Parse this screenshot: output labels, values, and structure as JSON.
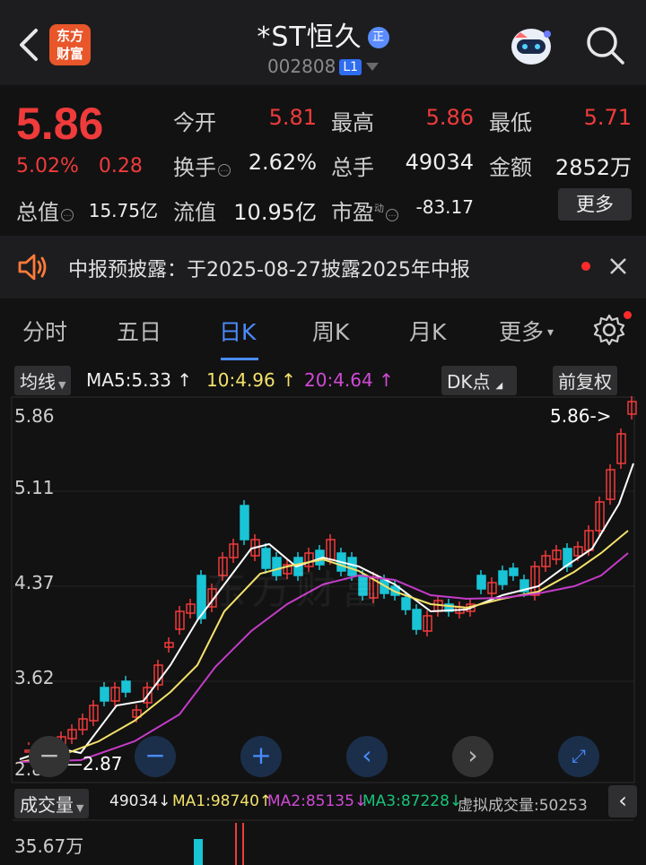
{
  "header": {
    "logo_line1": "东方",
    "logo_line2": "财富",
    "stock_name": "*ST恒久",
    "badge": "正",
    "stock_code": "002808",
    "level": "L1"
  },
  "quote": {
    "price": "5.86",
    "change_pct": "5.02%",
    "change_abs": "0.28",
    "open_label": "今开",
    "open_value": "5.81",
    "high_label": "最高",
    "high_value": "5.86",
    "low_label": "最低",
    "low_value": "5.71",
    "turnover_label": "换手",
    "turnover_value": "2.62%",
    "volume_label": "总手",
    "volume_value": "49034",
    "amount_label": "金额",
    "amount_value": "2852万",
    "mktcap_label": "总值",
    "mktcap_value": "15.75亿",
    "float_label": "流值",
    "float_value": "10.95亿",
    "pe_label": "市盈",
    "pe_sup": "动",
    "pe_value": "-83.17",
    "more_label": "更多"
  },
  "notice": {
    "text": "中报预披露：于2025-08-27披露2025年中报"
  },
  "tabs": [
    {
      "label": "分时"
    },
    {
      "label": "五日"
    },
    {
      "label": "日K"
    },
    {
      "label": "周K"
    },
    {
      "label": "月K"
    },
    {
      "label": "更多"
    }
  ],
  "ma_bar": {
    "indicator": "均线",
    "ma5": "MA5:5.33",
    "ma10": "10:4.96",
    "ma20": "20:4.64",
    "dk": "DK点",
    "adjust": "前复权"
  },
  "chart": {
    "y_labels": [
      "5.86",
      "5.11",
      "4.37",
      "3.62",
      "2.87"
    ],
    "last_price_tag": "5.86->",
    "low_tag": "2.87",
    "watermark": "东方财富",
    "colors": {
      "up": "#ef3b3b",
      "down": "#19c4d6",
      "ma5": "#ffffff",
      "ma10": "#f3e26a",
      "ma20": "#c43cc8"
    }
  },
  "volume_bar": {
    "label": "成交量",
    "value": "49034",
    "ma1": "MA1:98740",
    "ma2": "MA2:85135",
    "ma3": "MA3:87228",
    "virtual": "虚拟成交量:50253",
    "axis_top": "35.67万"
  }
}
